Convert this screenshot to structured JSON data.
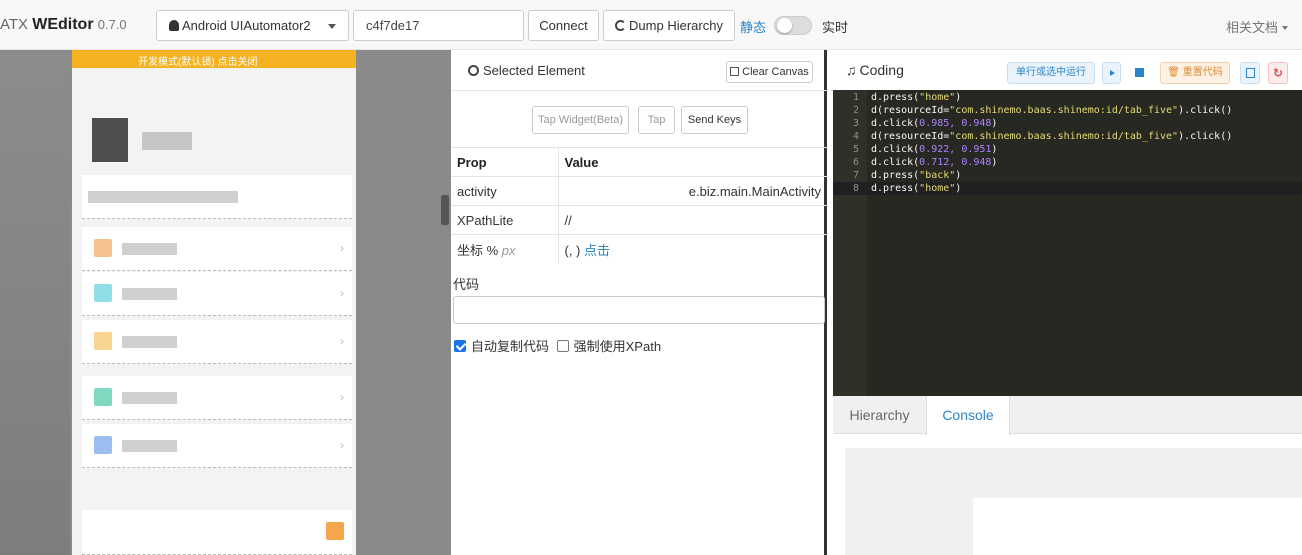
{
  "app": {
    "brand_prefix": "ATX",
    "brand_name": "WEditor",
    "version": "0.7.0"
  },
  "toolbar": {
    "platform": "Android UIAutomator2",
    "serial": "c4f7de17",
    "connect_label": "Connect",
    "dump_label": "Dump Hierarchy",
    "mode_static": "静态",
    "mode_live": "实时",
    "docs_label": "相关文档"
  },
  "device": {
    "notice_text": "开发模式(默认锁)  点击关闭"
  },
  "selected": {
    "title": "Selected Element",
    "clear_label": "Clear Canvas",
    "actions": [
      "Tap Widget(Beta)",
      "Tap",
      "Send Keys"
    ],
    "headers": [
      "Prop",
      "Value"
    ],
    "rows": [
      {
        "key": "activity",
        "value": "e.biz.main.MainActivity"
      },
      {
        "key": "XPathLite",
        "value": "//"
      },
      {
        "key": "坐标 %",
        "unit": "px",
        "value": "(, )",
        "link": "点击"
      }
    ],
    "code_label": "代码",
    "auto_copy_label": "自动复制代码",
    "force_xpath_label": "强制使用XPath"
  },
  "coding": {
    "title": "Coding",
    "run_selected_label": "单行或选中运行",
    "reset_label": "重置代码",
    "lines": [
      [
        "d.press(",
        "\"home\"",
        ")"
      ],
      [
        "d(resourceId=",
        "\"com.shinemo.baas.shinemo:id/tab_five\"",
        ").click()"
      ],
      [
        "d.click(",
        "0.985, 0.948",
        ")"
      ],
      [
        "d(resourceId=",
        "\"com.shinemo.baas.shinemo:id/tab_five\"",
        ").click()"
      ],
      [
        "d.click(",
        "0.922, 0.951",
        ")"
      ],
      [
        "d.click(",
        "0.712, 0.948",
        ")"
      ],
      [
        "d.press(",
        "\"back\"",
        ")"
      ],
      [
        "d.press(",
        "\"home\"",
        ")"
      ]
    ]
  },
  "tabs": {
    "hierarchy": "Hierarchy",
    "console": "Console"
  },
  "colors": {
    "accent": "#2a86c9",
    "editor_bg": "#272822",
    "notice": "#f4b223"
  }
}
